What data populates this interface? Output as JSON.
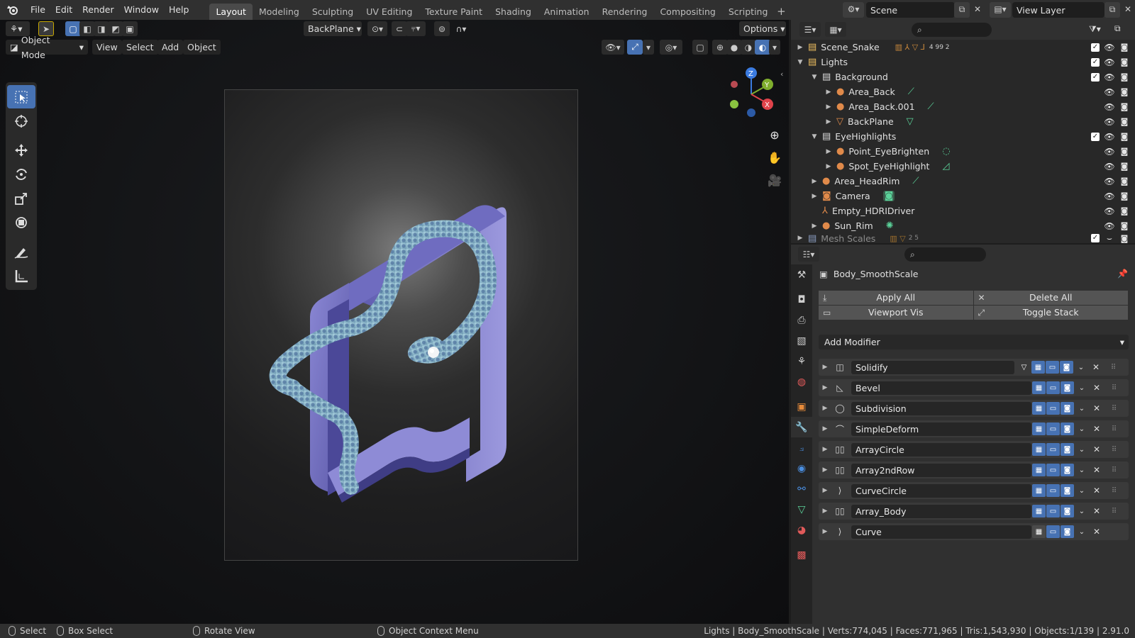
{
  "menu": {
    "items": [
      "File",
      "Edit",
      "Render",
      "Window",
      "Help"
    ]
  },
  "workspaces": {
    "tabs": [
      "Layout",
      "Modeling",
      "Sculpting",
      "UV Editing",
      "Texture Paint",
      "Shading",
      "Animation",
      "Rendering",
      "Compositing",
      "Scripting"
    ],
    "active": "Layout",
    "add": "+"
  },
  "scene": {
    "name": "Scene",
    "view_layer": "View Layer"
  },
  "tool_header": {
    "active_object": "BackPlane",
    "options": "Options"
  },
  "viewport_header": {
    "mode": "Object Mode",
    "view": "View",
    "select": "Select",
    "add": "Add",
    "object": "Object"
  },
  "gizmo": {
    "z": "Z",
    "y": "Y",
    "x": "X"
  },
  "outliner": {
    "rows": [
      {
        "label": "Scene_Snake",
        "counts": "4   99 2"
      },
      {
        "label": "Lights"
      },
      {
        "label": "Background"
      },
      {
        "label": "Area_Back"
      },
      {
        "label": "Area_Back.001"
      },
      {
        "label": "BackPlane"
      },
      {
        "label": "EyeHighlights"
      },
      {
        "label": "Point_EyeBrighten"
      },
      {
        "label": "Spot_EyeHighlight"
      },
      {
        "label": "Area_HeadRim"
      },
      {
        "label": "Camera"
      },
      {
        "label": "Empty_HDRIDriver"
      },
      {
        "label": "Sun_Rim"
      },
      {
        "label": "Mesh Scales",
        "counts": "2   5"
      }
    ]
  },
  "properties": {
    "object_name": "Body_SmoothScale",
    "apply_all": "Apply All",
    "delete_all": "Delete All",
    "viewport_vis": "Viewport Vis",
    "toggle_stack": "Toggle Stack",
    "add_modifier": "Add Modifier",
    "modifiers": [
      {
        "name": "Solidify",
        "icon": "solidify-icon"
      },
      {
        "name": "Bevel",
        "icon": "bevel-icon"
      },
      {
        "name": "Subdivision",
        "icon": "subdivision-icon"
      },
      {
        "name": "SimpleDeform",
        "icon": "simpledeform-icon"
      },
      {
        "name": "ArrayCircle",
        "icon": "array-icon"
      },
      {
        "name": "Array2ndRow",
        "icon": "array-icon"
      },
      {
        "name": "CurveCircle",
        "icon": "curve-icon"
      },
      {
        "name": "Array_Body",
        "icon": "array-icon"
      },
      {
        "name": "Curve",
        "icon": "curve-icon"
      }
    ]
  },
  "statusbar": {
    "select": "Select",
    "box_select": "Box Select",
    "rotate_view": "Rotate View",
    "context_menu": "Object Context Menu",
    "stats": "Lights | Body_SmoothScale | Verts:774,045 | Faces:771,965 | Tris:1,543,930 | Objects:1/139 | 2.91.0"
  },
  "colors": {
    "accent": "#4772b3",
    "active_tab": "#4a4a4a",
    "frame_purple": "#7b78c6",
    "snake_scales": "#8fb8c9",
    "snake_dark": "#2e4a78"
  }
}
